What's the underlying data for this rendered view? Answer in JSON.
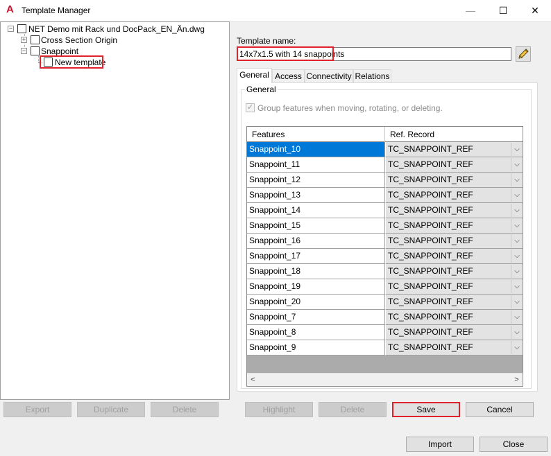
{
  "window": {
    "title": "Template Manager",
    "app_icon_glyph": "A",
    "minimize_glyph": "—",
    "maximize_glyph": "☐",
    "close_glyph": "✕"
  },
  "tree": {
    "root": {
      "label": "NET Demo mit Rack und DocPack_EN_Än.dwg",
      "expander": "−"
    },
    "children": [
      {
        "label": "Cross Section Origin",
        "expander": "+"
      },
      {
        "label": "Snappoint",
        "expander": "−"
      }
    ],
    "grandchild": {
      "label": "New template"
    }
  },
  "left_buttons": {
    "export": "Export",
    "duplicate": "Duplicate",
    "delete": "Delete"
  },
  "template": {
    "name_label": "Template name:",
    "name_value": "14x7x1.5 with 14 snappoints"
  },
  "tabs": [
    "General",
    "Access",
    "Connectivity",
    "Relations"
  ],
  "general": {
    "group_title": "General",
    "checkbox_label": "Group features when moving, rotating, or deleting."
  },
  "grid": {
    "headers": [
      "Features",
      "Ref. Record"
    ],
    "rows": [
      {
        "feature": "Snappoint_10",
        "ref": "TC_SNAPPOINT_REF"
      },
      {
        "feature": "Snappoint_11",
        "ref": "TC_SNAPPOINT_REF"
      },
      {
        "feature": "Snappoint_12",
        "ref": "TC_SNAPPOINT_REF"
      },
      {
        "feature": "Snappoint_13",
        "ref": "TC_SNAPPOINT_REF"
      },
      {
        "feature": "Snappoint_14",
        "ref": "TC_SNAPPOINT_REF"
      },
      {
        "feature": "Snappoint_15",
        "ref": "TC_SNAPPOINT_REF"
      },
      {
        "feature": "Snappoint_16",
        "ref": "TC_SNAPPOINT_REF"
      },
      {
        "feature": "Snappoint_17",
        "ref": "TC_SNAPPOINT_REF"
      },
      {
        "feature": "Snappoint_18",
        "ref": "TC_SNAPPOINT_REF"
      },
      {
        "feature": "Snappoint_19",
        "ref": "TC_SNAPPOINT_REF"
      },
      {
        "feature": "Snappoint_20",
        "ref": "TC_SNAPPOINT_REF"
      },
      {
        "feature": "Snappoint_7",
        "ref": "TC_SNAPPOINT_REF"
      },
      {
        "feature": "Snappoint_8",
        "ref": "TC_SNAPPOINT_REF"
      },
      {
        "feature": "Snappoint_9",
        "ref": "TC_SNAPPOINT_REF"
      }
    ],
    "dropdown_glyph": "⌵",
    "scroll_left_glyph": "<",
    "scroll_right_glyph": ">"
  },
  "right_buttons": {
    "highlight": "Highlight",
    "delete": "Delete",
    "save": "Save",
    "cancel": "Cancel"
  },
  "footer_buttons": {
    "import": "Import",
    "close": "Close"
  }
}
